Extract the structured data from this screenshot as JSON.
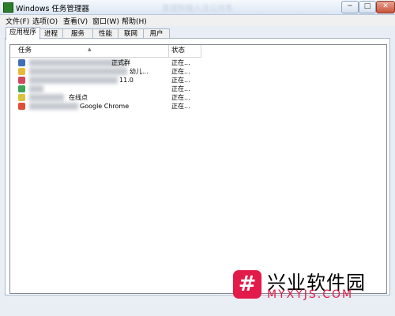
{
  "window": {
    "title": "Windows 任务管理器",
    "blurred_title": "某搜狗输入法公共条"
  },
  "menu": [
    {
      "label": "文件(F)"
    },
    {
      "label": "选项(O)"
    },
    {
      "label": "查看(V)"
    },
    {
      "label": "窗口(W)"
    },
    {
      "label": "帮助(H)"
    }
  ],
  "tabs": [
    {
      "label": "应用程序",
      "active": true
    },
    {
      "label": "进程",
      "active": false
    },
    {
      "label": "服务",
      "active": false
    },
    {
      "label": "性能",
      "active": false
    },
    {
      "label": "联网",
      "active": false
    },
    {
      "label": "用户",
      "active": false
    }
  ],
  "columns": {
    "task": "任务",
    "status": "状态"
  },
  "tasks": [
    {
      "name": "正式群",
      "icon_color": "#3f6fb6",
      "status": "正在..."
    },
    {
      "name": "幼儿...",
      "icon_color": "#e6b93b",
      "status": "正在..."
    },
    {
      "name": "11.0",
      "icon_color": "#d2475d",
      "status": "正在..."
    },
    {
      "name": "",
      "icon_color": "#3aa457",
      "status": "正在..."
    },
    {
      "name": "在线点",
      "icon_color": "#d9c23c",
      "status": "正在..."
    },
    {
      "name": "Google Chrome",
      "icon_color": "#e04f35",
      "status": "正在..."
    }
  ],
  "watermark": {
    "glyph": "#",
    "text": "兴业软件园",
    "url": "MYXYJS.COM"
  }
}
